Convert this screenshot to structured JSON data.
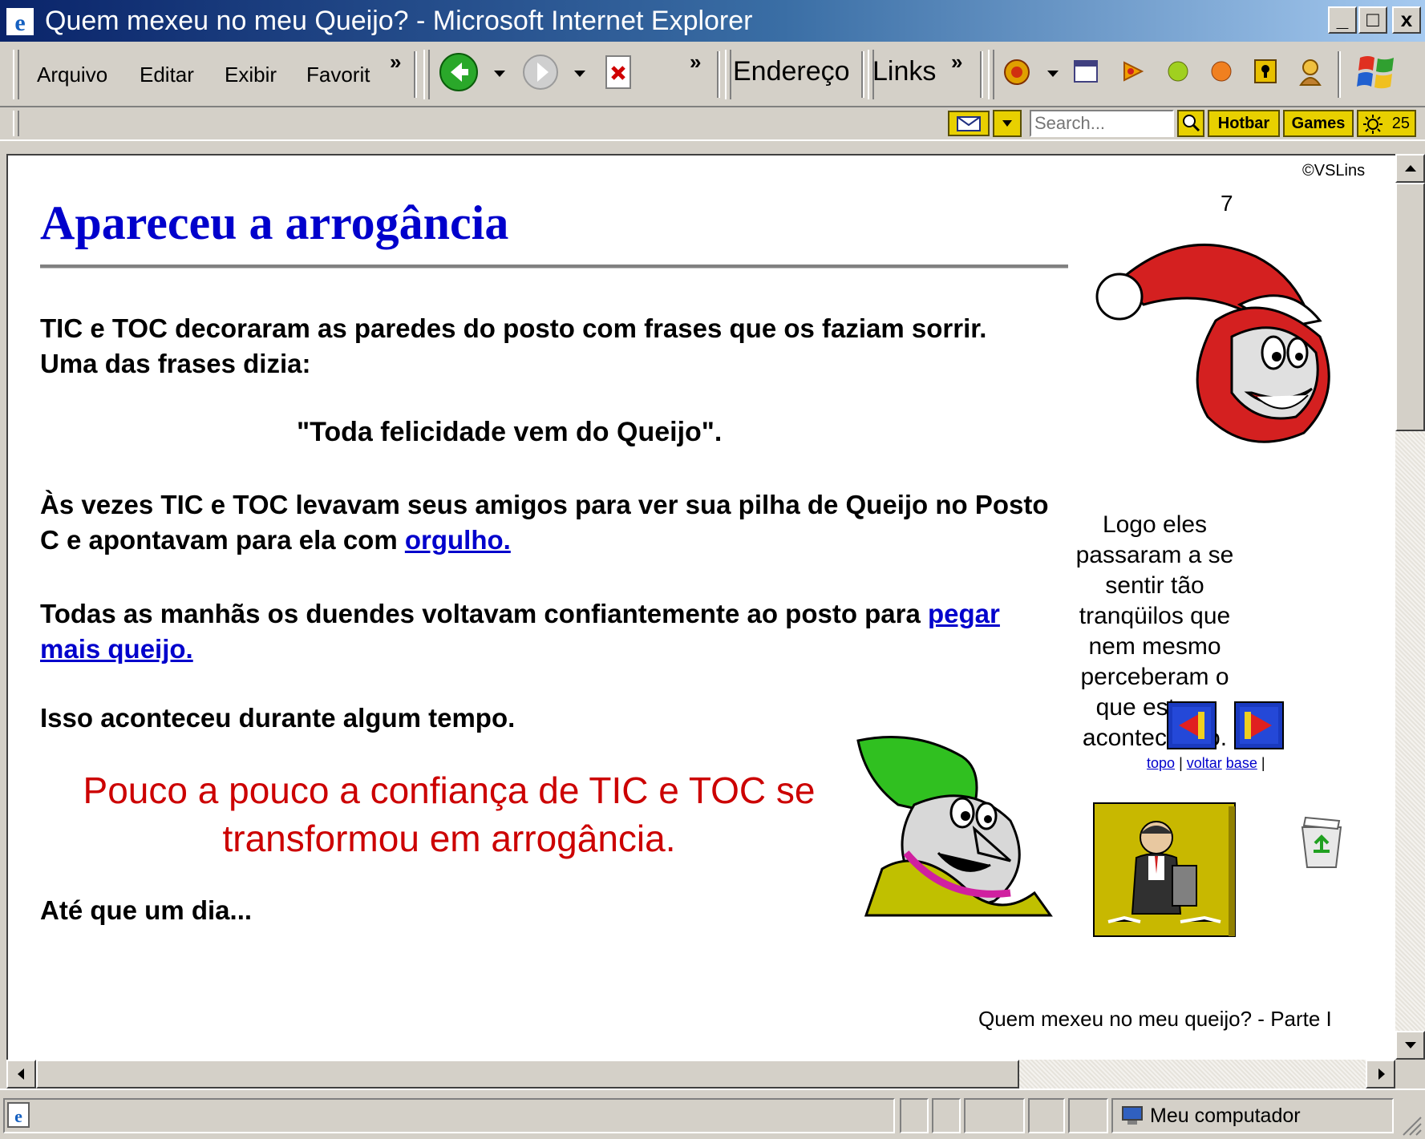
{
  "window": {
    "title": "Quem mexeu no meu Queijo? - Microsoft Internet Explorer",
    "minimize": "_",
    "maximize": "□",
    "close": "x"
  },
  "menu": {
    "items": [
      "Arquivo",
      "Editar",
      "Exibir",
      "Favorit"
    ],
    "more": "»"
  },
  "toolbar": {
    "more": "»",
    "address_label": "Endereço",
    "links_label": "Links",
    "links_more": "»"
  },
  "toolbar2": {
    "search_placeholder": "Search...",
    "hotbar": "Hotbar",
    "games": "Games",
    "weather": "25"
  },
  "page": {
    "copyright": "©VSLins",
    "page_number": "7",
    "heading": "Apareceu a arrogância",
    "para1": "TIC e TOC decoraram as paredes do posto com frases que os faziam sorrir. Uma das frases dizia:",
    "quote": "\"Toda felicidade vem do Queijo\".",
    "para2_text": "Às vezes TIC e TOC levavam seus amigos para ver sua pilha de Queijo no Posto C e apontavam para ela com ",
    "para2_link": "orgulho.",
    "para3_text": "Todas as manhãs os duendes voltavam confiantemente ao posto para ",
    "para3_link": "pegar mais queijo.",
    "para4": "Isso aconteceu durante algum tempo.",
    "red_text": "Pouco a pouco a confiança de TIC e TOC se transformou em arrogância.",
    "para5": "Até que um dia...",
    "side_caption": "Logo eles passaram a se sentir tão tranqüilos que nem mesmo perceberam o que estava acontecendo.",
    "nav": {
      "topo": "topo",
      "voltar": "voltar",
      "base": "base",
      "sep": "|"
    },
    "footer": "Quem mexeu no meu queijo? - Parte I"
  },
  "status": {
    "zone": "Meu computador"
  },
  "colors": {
    "heading": "#0000cc",
    "red_text": "#cc0000",
    "link": "#0000cc",
    "titlebar": "#0a246a"
  }
}
